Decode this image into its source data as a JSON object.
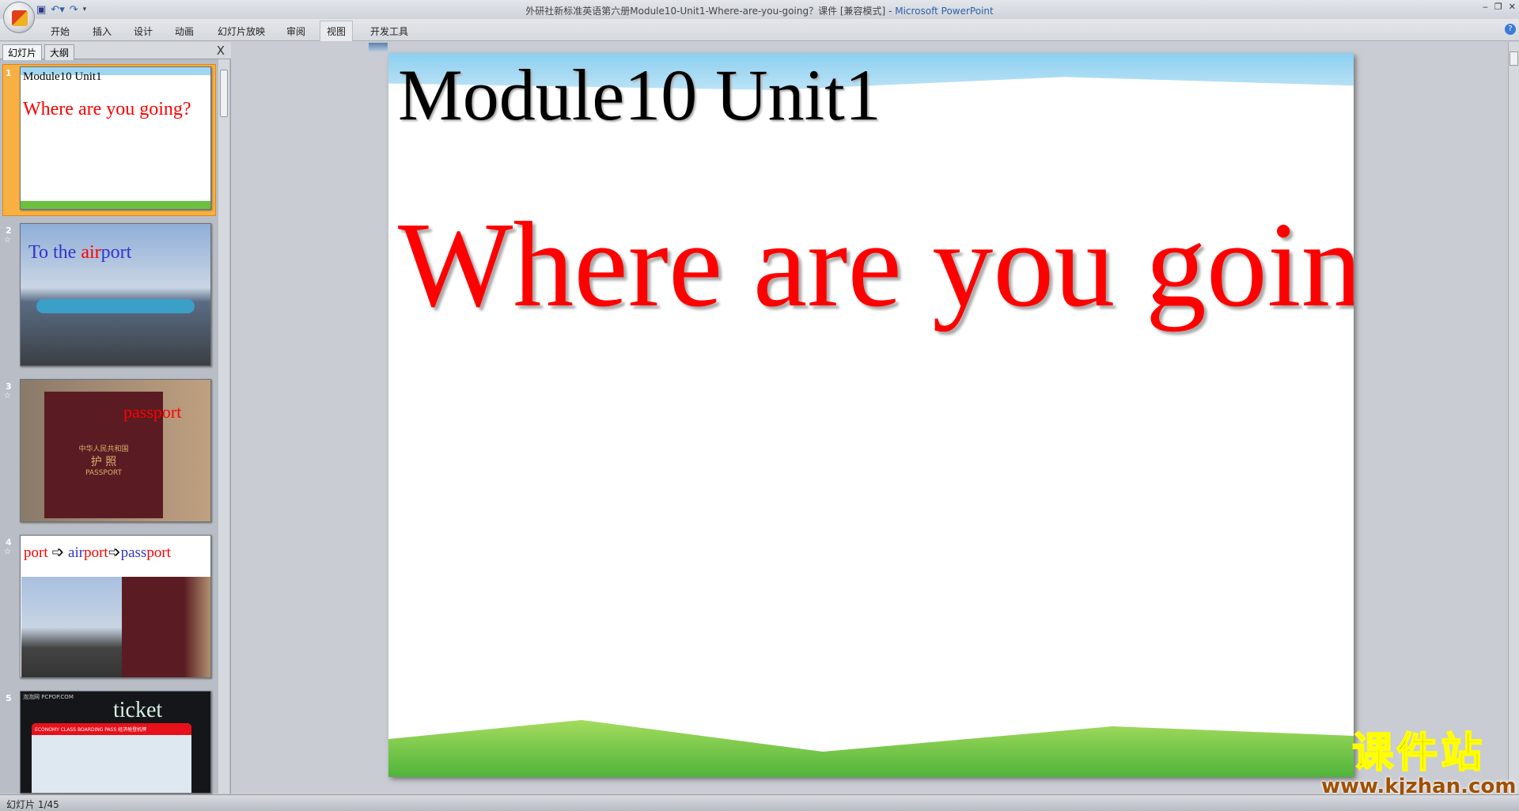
{
  "window": {
    "title": "外研社新标准英语第六册Module10-Unit1-Where-are-you-going？课件 [兼容模式]",
    "app": "Microsoft PowerPoint",
    "controls": [
      "‒",
      "❐",
      "✕"
    ]
  },
  "qat": {
    "icons": [
      "save-icon",
      "undo-icon",
      "redo-icon",
      "customize-icon"
    ]
  },
  "ribbon": {
    "tabs": [
      "开始",
      "插入",
      "设计",
      "动画",
      "幻灯片放映",
      "审阅",
      "视图",
      "开发工具"
    ],
    "active": "视图"
  },
  "pane": {
    "tabs": [
      "幻灯片",
      "大纲"
    ],
    "close": "X"
  },
  "thumbs": [
    {
      "num": "1",
      "title": "Module10 Unit1",
      "subtitle": "Where are you going?"
    },
    {
      "num": "2",
      "parts": [
        "To the",
        "air",
        "port"
      ]
    },
    {
      "num": "3",
      "word": "passport",
      "labels": [
        "中华人民共和国",
        "护 照",
        "PASSPORT"
      ]
    },
    {
      "num": "4",
      "parts": [
        "port",
        "➩",
        "air",
        "port",
        "➩",
        "pass",
        "port"
      ]
    },
    {
      "num": "5",
      "word": "ticket",
      "banner": "ECONOMY CLASS BOARDING PASS 经济舱登机牌",
      "site": "泡泡网 PCPOP.COM"
    }
  ],
  "slide": {
    "title": "Module10 Unit1",
    "subtitle": "Where are you going?"
  },
  "status": {
    "text": "幻灯片 1/45"
  },
  "watermark": {
    "cn": "课件站",
    "url": "www.kjzhan.com"
  },
  "colors": {
    "red": "#ff0000",
    "blue": "#3333cc",
    "selection": "#f7b041"
  }
}
